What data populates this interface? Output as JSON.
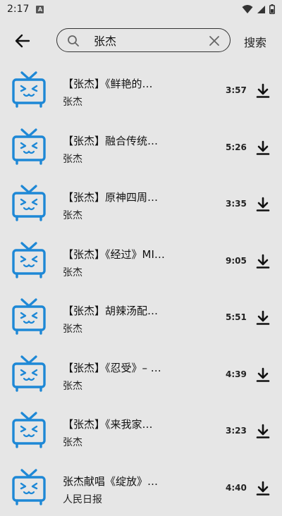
{
  "status_bar": {
    "time": "2:17",
    "notif_letter": "A"
  },
  "search": {
    "query": "张杰",
    "button_label": "搜索"
  },
  "results": [
    {
      "title": "【张杰】《鲜艳的…",
      "artist": "张杰",
      "duration": "3:57"
    },
    {
      "title": "【张杰】融合传统…",
      "artist": "张杰",
      "duration": "5:26"
    },
    {
      "title": "【张杰】原神四周…",
      "artist": "张杰",
      "duration": "3:35"
    },
    {
      "title": "【张杰】《经过》MI…",
      "artist": "张杰",
      "duration": "9:05"
    },
    {
      "title": "【张杰】胡辣汤配…",
      "artist": "张杰",
      "duration": "5:51"
    },
    {
      "title": "【张杰】《忍受》– …",
      "artist": "张杰",
      "duration": "4:39"
    },
    {
      "title": "【张杰】《来我家…",
      "artist": "张杰",
      "duration": "3:23"
    },
    {
      "title": "张杰献唱《绽放》…",
      "artist": "人民日报",
      "duration": "4:40"
    }
  ],
  "colors": {
    "tv_icon": "#1e88d6",
    "background": "#e6e6e6"
  },
  "icons": {
    "back": "arrow-left-icon",
    "search": "search-icon",
    "clear": "close-icon",
    "download": "download-icon",
    "thumbnail": "tv-icon"
  }
}
